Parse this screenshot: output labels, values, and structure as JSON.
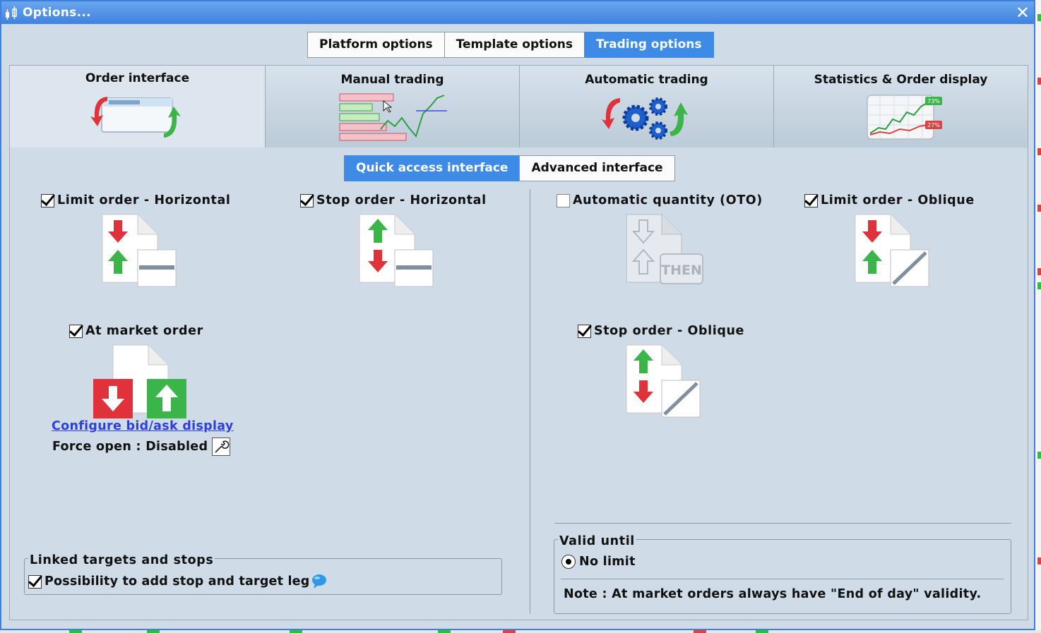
{
  "window": {
    "title": "Options...",
    "close_label": "✕"
  },
  "top_tabs": [
    {
      "label": "Platform options",
      "active": false
    },
    {
      "label": "Template options",
      "active": false
    },
    {
      "label": "Trading options",
      "active": true
    }
  ],
  "category_tabs": [
    {
      "label": "Order interface",
      "active": true
    },
    {
      "label": "Manual trading",
      "active": false
    },
    {
      "label": "Automatic trading",
      "active": false
    },
    {
      "label": "Statistics & Order display",
      "active": false
    }
  ],
  "stats_badges": {
    "high": "73%",
    "low": "27%"
  },
  "sub_tabs": [
    {
      "label": "Quick access interface",
      "active": true
    },
    {
      "label": "Advanced interface",
      "active": false
    }
  ],
  "options": {
    "limit_horizontal": {
      "label": "Limit order - Horizontal",
      "checked": true
    },
    "stop_horizontal": {
      "label": "Stop order - Horizontal",
      "checked": true
    },
    "auto_quantity": {
      "label": "Automatic quantity (OTO)",
      "checked": false,
      "icon_text": "THEN"
    },
    "limit_oblique": {
      "label": "Limit order - Oblique",
      "checked": true
    },
    "at_market": {
      "label": "At market order",
      "checked": true
    },
    "stop_oblique": {
      "label": "Stop order - Oblique",
      "checked": true
    }
  },
  "configure_link": "Configure bid/ask display",
  "force_open": "Force open : Disabled",
  "linked_group": {
    "legend": "Linked targets and stops",
    "option_label": "Possibility to add stop and target leg",
    "checked": true
  },
  "valid_until": {
    "legend": "Valid until",
    "option_label": "No limit",
    "selected": true,
    "note": "Note : At market orders always have \"End of day\" validity."
  },
  "colors": {
    "accent": "#3d8be6",
    "title_bar": "#4a8ee6",
    "panel": "#cfdbe6",
    "link": "#2d3fe0",
    "arrow_red": "#e0323a",
    "arrow_green": "#3bb54a"
  }
}
